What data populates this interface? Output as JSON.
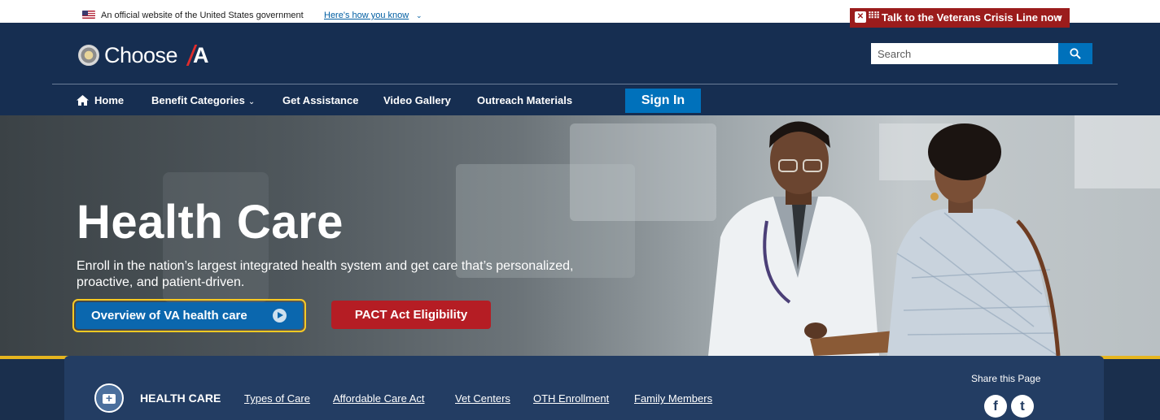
{
  "gov_banner": {
    "official_text": "An official website of the United States government",
    "how_link": "Here's how you know",
    "how_chevron": "⌄"
  },
  "crisis": {
    "label": "Talk to the Veterans Crisis Line now",
    "icon": "✕",
    "dots": "⠿⠿",
    "arrow": "›",
    "bg_color": "#9b1c1c"
  },
  "header": {
    "logo_text": "Choose ",
    "logo_accent": "A",
    "search_placeholder": "Search",
    "bg_color": "#162e51"
  },
  "nav": {
    "items": [
      {
        "label": "Home",
        "icon": "home-icon"
      },
      {
        "label": "Benefit Categories",
        "chevron": "⌄"
      },
      {
        "label": "Get Assistance"
      },
      {
        "label": "Video Gallery"
      },
      {
        "label": "Outreach Materials"
      }
    ],
    "sign_in": "Sign In"
  },
  "hero": {
    "title": "Health Care",
    "description": "Enroll in the nation’s largest integrated health system and get care that’s personalized, proactive, and patient-driven.",
    "primary_button": "Overview of VA health care",
    "secondary_button": "PACT Act Eligibility"
  },
  "subnav": {
    "section_label": "HEALTH CARE",
    "links": [
      "Types of Care",
      "Affordable Care Act",
      "Vet Centers",
      "OTH Enrollment",
      "Family Members"
    ],
    "share_label": "Share this Page",
    "social": [
      {
        "icon": "facebook-icon",
        "glyph": "f"
      },
      {
        "icon": "twitter-icon",
        "glyph": "t"
      }
    ]
  },
  "colors": {
    "accent_blue": "#0071bb",
    "gold": "#fac922",
    "red": "#b51d24"
  }
}
